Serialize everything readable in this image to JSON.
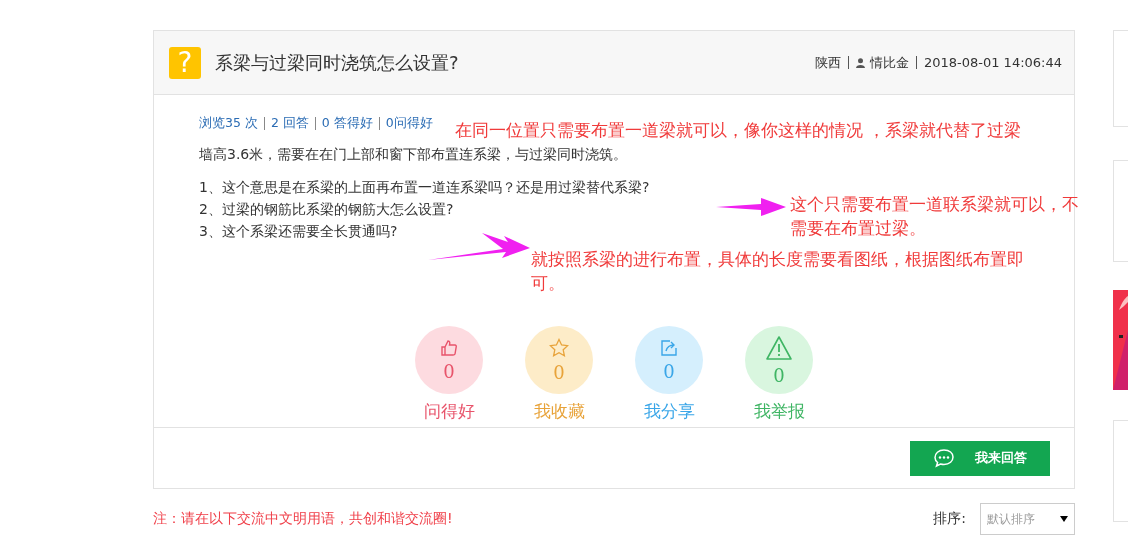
{
  "question": {
    "icon": "?",
    "title": "系梁与过梁同时浇筑怎么设置?",
    "region": "陕西",
    "user": "情比金",
    "date": "2018-08-01 14:06:44"
  },
  "stats": [
    "浏览35 次",
    "2 回答",
    "0 答得好",
    "0问得好"
  ],
  "body": [
    "墙高3.6米，需要在在门上部和窗下部布置连系梁，与过梁同时浇筑。"
  ],
  "points": [
    "1、这个意思是在系梁的上面再布置一道连系梁吗？还是用过梁替代系梁?",
    "2、过梁的钢筋比系梁的钢筋大怎么设置?",
    "3、这个系梁还需要全长贯通吗?"
  ],
  "annotations": [
    "在同一位置只需要布置一道梁就可以，像你这样的情况 ，系梁就代替了过梁",
    "这个只需要布置一道联系梁就可以，不需要在布置过梁。",
    "就按照系梁的进行布置，具体的长度需要看图纸，根据图纸布置即可。"
  ],
  "actions": [
    {
      "kind": "like",
      "count": "0",
      "label": "问得好",
      "color": "#e8546b"
    },
    {
      "kind": "star",
      "count": "0",
      "label": "我收藏",
      "color": "#e8a33a"
    },
    {
      "kind": "share",
      "count": "0",
      "label": "我分享",
      "color": "#3aa6e8"
    },
    {
      "kind": "report",
      "count": "0",
      "label": "我举报",
      "color": "#3fb564"
    }
  ],
  "answer_button": "我来回答",
  "notice": "注：请在以下交流中文明用语，共创和谐交流圈!",
  "sort": {
    "label": "排序:",
    "value": "默认排序"
  }
}
